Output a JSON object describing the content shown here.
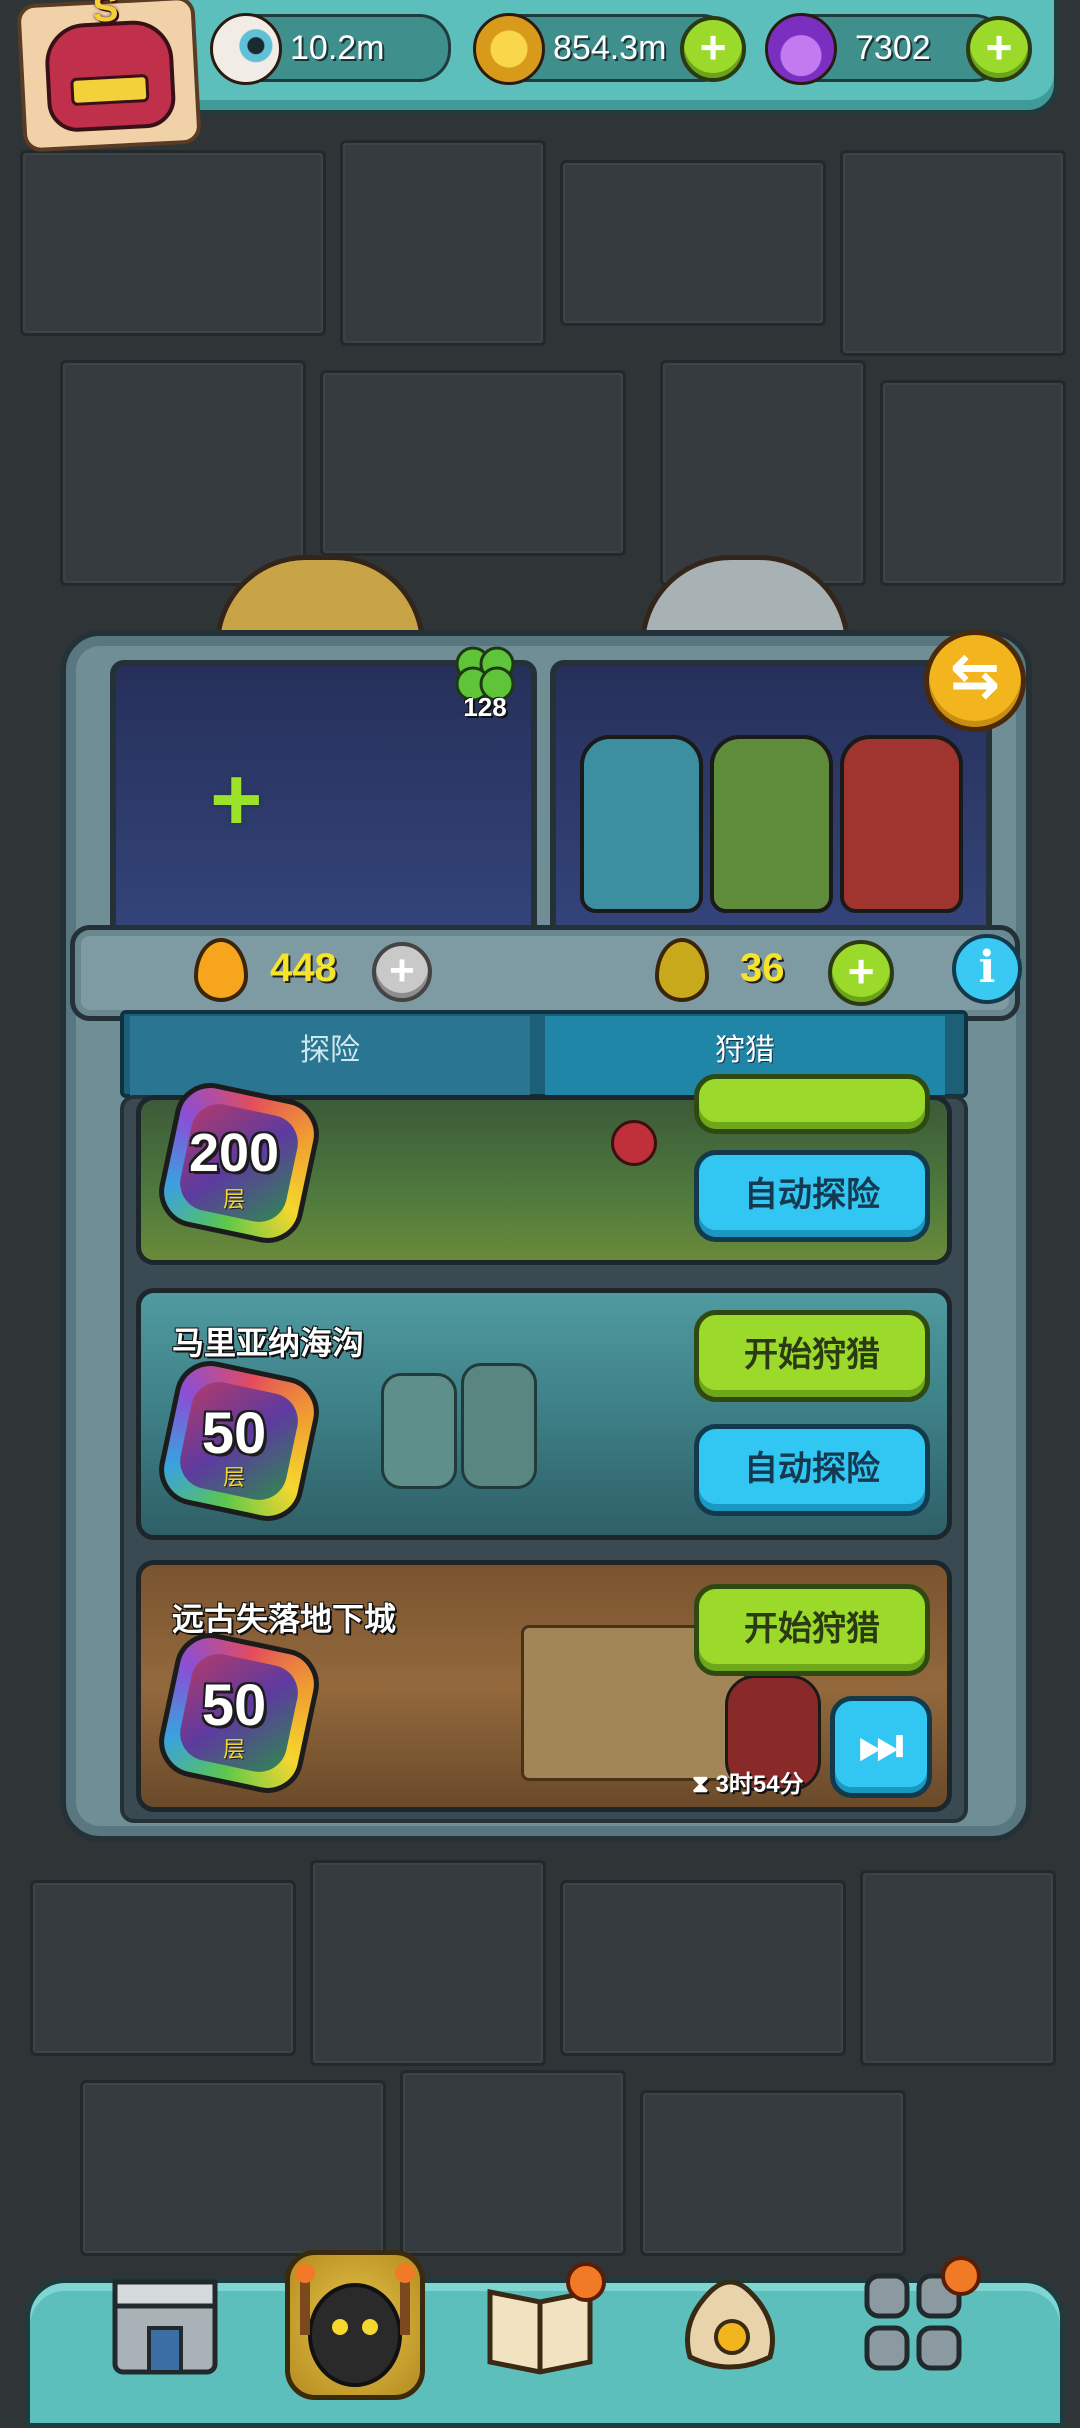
{
  "resources": {
    "eyes": {
      "value": "10.2m",
      "icon": "eyeball-icon"
    },
    "coins": {
      "value": "854.3m",
      "icon": "gold-coin-icon"
    },
    "potions": {
      "value": "7302",
      "icon": "purple-potion-icon"
    }
  },
  "player": {
    "rank_letter": "S",
    "icon": "monster-avatar-icon"
  },
  "machine": {
    "clover_count": "128",
    "energy_left": "448",
    "energy_right": "36"
  },
  "tabs": [
    {
      "label": "探险",
      "active": false
    },
    {
      "label": "狩猎",
      "active": true
    }
  ],
  "levels": [
    {
      "title": "",
      "floor_number": "200",
      "floor_unit": "层",
      "primary_label": "",
      "secondary_label": "自动探险"
    },
    {
      "title": "马里亚纳海沟",
      "floor_number": "50",
      "floor_unit": "层",
      "primary_label": "开始狩猎",
      "secondary_label": "自动探险"
    },
    {
      "title": "远古失落地下城",
      "floor_number": "50",
      "floor_unit": "层",
      "primary_label": "开始狩猎",
      "timer": "3时54分"
    }
  ],
  "bottom_nav": [
    {
      "icon": "shop-building-icon",
      "selected": false,
      "notification": false
    },
    {
      "icon": "monster-lair-icon",
      "selected": true,
      "notification": false
    },
    {
      "icon": "book-icon",
      "selected": false,
      "notification": true
    },
    {
      "icon": "money-bag-icon",
      "selected": false,
      "notification": false
    },
    {
      "icon": "grid-menu-icon",
      "selected": false,
      "notification": true
    }
  ],
  "colors": {
    "teal_bar": "#5cbfbc",
    "green_button": "#9bd92a",
    "blue_button": "#32c7f2",
    "energy_yellow": "#f6e32b",
    "background": "#2f3437"
  }
}
